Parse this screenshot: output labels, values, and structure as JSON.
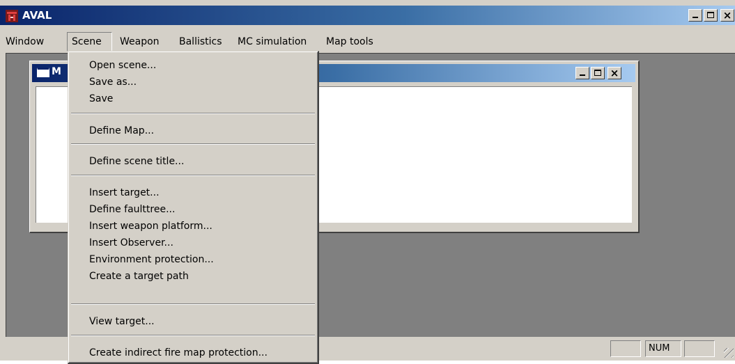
{
  "app": {
    "title": "AVAL"
  },
  "menubar": {
    "items": [
      {
        "label": "Window"
      },
      {
        "label": "Scene"
      },
      {
        "label": "Weapon"
      },
      {
        "label": "Ballistics"
      },
      {
        "label": "MC simulation"
      },
      {
        "label": "Map tools"
      }
    ],
    "active": "Scene"
  },
  "scene_menu": {
    "items": [
      "Open scene...",
      "Save as...",
      "Save",
      "Define Map...",
      "Define scene title...",
      "Insert target...",
      "Define faulttree...",
      "Insert weapon platform...",
      "Insert Observer...",
      "Environment protection...",
      "Create a target path",
      "View target...",
      "Create indirect fire map protection..."
    ]
  },
  "child_window": {
    "title": "M"
  },
  "statusbar": {
    "num": "NUM"
  },
  "icons": {
    "app": "aval-app-icon",
    "minimize": "minimize-icon",
    "maximize": "maximize-icon",
    "close": "close-icon"
  },
  "colors": {
    "titlebar_start": "#0a246a",
    "titlebar_end": "#a6caf0",
    "face": "#d4d0c8",
    "mdi_bg": "#808080"
  }
}
